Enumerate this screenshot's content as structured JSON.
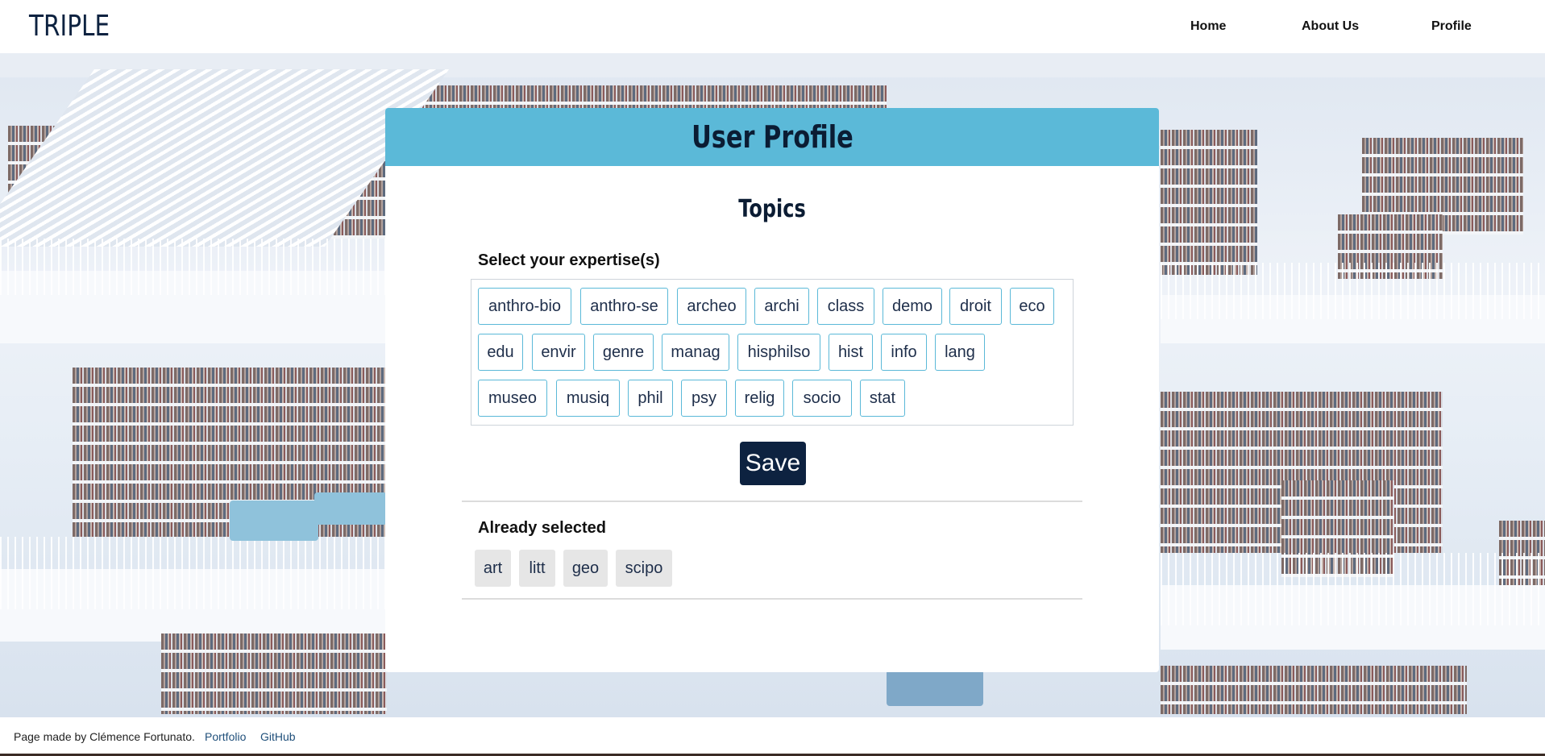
{
  "header": {
    "logo": "TRIPLE",
    "nav": [
      "Home",
      "About Us",
      "Profile"
    ]
  },
  "card": {
    "title": "User Profile",
    "section_title": "Topics",
    "expertise_label": "Select your expertise(s)",
    "topics": [
      "anthro-bio",
      "anthro-se",
      "archeo",
      "archi",
      "class",
      "demo",
      "droit",
      "eco",
      "edu",
      "envir",
      "genre",
      "manag",
      "hisphilso",
      "hist",
      "info",
      "lang",
      "museo",
      "musiq",
      "phil",
      "psy",
      "relig",
      "socio",
      "stat"
    ],
    "save_label": "Save",
    "selected_label": "Already selected",
    "selected": [
      "art",
      "litt",
      "geo",
      "scipo"
    ]
  },
  "footer": {
    "credit": "Page made by Clémence Fortunato.",
    "links": [
      "Portfolio",
      "GitHub"
    ]
  },
  "colors": {
    "header_bar": "#5bb9d8",
    "navy": "#0d2240",
    "chip_border": "#5bb9d8",
    "selected_chip_bg": "#e6e6e6"
  }
}
